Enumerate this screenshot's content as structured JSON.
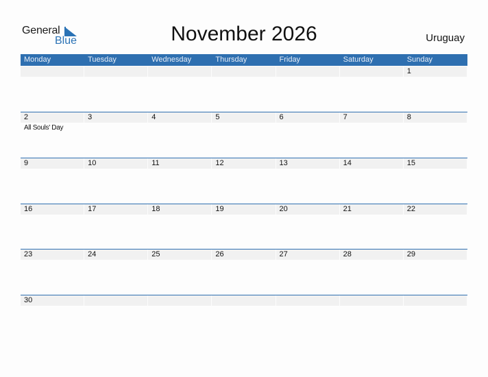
{
  "logo": {
    "word1": "General",
    "word2": "Blue"
  },
  "title": "November 2026",
  "country": "Uruguay",
  "weekdays": [
    "Monday",
    "Tuesday",
    "Wednesday",
    "Thursday",
    "Friday",
    "Saturday",
    "Sunday"
  ],
  "weeks": [
    [
      {
        "d": ""
      },
      {
        "d": ""
      },
      {
        "d": ""
      },
      {
        "d": ""
      },
      {
        "d": ""
      },
      {
        "d": ""
      },
      {
        "d": "1"
      }
    ],
    [
      {
        "d": "2",
        "holiday": "All Souls' Day"
      },
      {
        "d": "3"
      },
      {
        "d": "4"
      },
      {
        "d": "5"
      },
      {
        "d": "6"
      },
      {
        "d": "7"
      },
      {
        "d": "8"
      }
    ],
    [
      {
        "d": "9"
      },
      {
        "d": "10"
      },
      {
        "d": "11"
      },
      {
        "d": "12"
      },
      {
        "d": "13"
      },
      {
        "d": "14"
      },
      {
        "d": "15"
      }
    ],
    [
      {
        "d": "16"
      },
      {
        "d": "17"
      },
      {
        "d": "18"
      },
      {
        "d": "19"
      },
      {
        "d": "20"
      },
      {
        "d": "21"
      },
      {
        "d": "22"
      }
    ],
    [
      {
        "d": "23"
      },
      {
        "d": "24"
      },
      {
        "d": "25"
      },
      {
        "d": "26"
      },
      {
        "d": "27"
      },
      {
        "d": "28"
      },
      {
        "d": "29"
      }
    ],
    [
      {
        "d": "30"
      },
      {
        "d": ""
      },
      {
        "d": ""
      },
      {
        "d": ""
      },
      {
        "d": ""
      },
      {
        "d": ""
      },
      {
        "d": ""
      }
    ]
  ],
  "colors": {
    "accent": "#2e6fb0",
    "strip": "#f1f1f1"
  }
}
